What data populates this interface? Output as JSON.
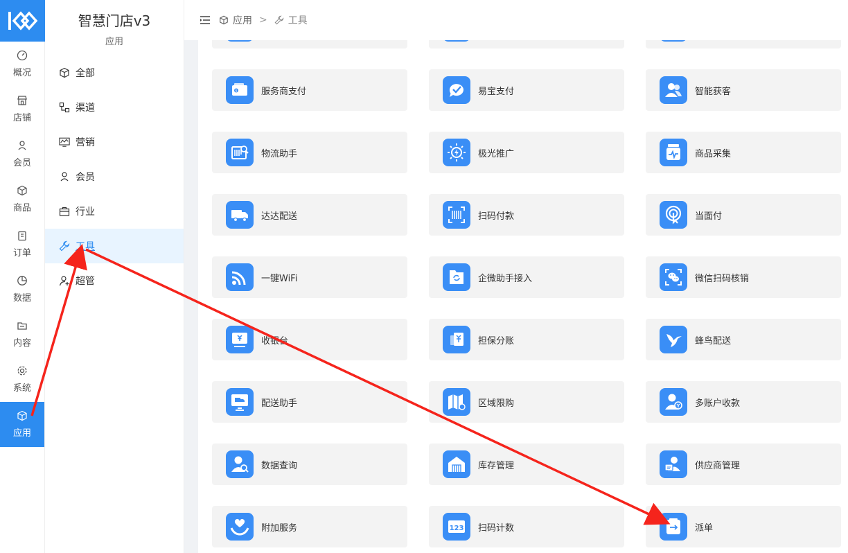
{
  "app": {
    "brand_color": "#2d8cf0",
    "title": "智慧门店v3",
    "subtitle": "应用"
  },
  "rail": {
    "items": [
      {
        "label": "概况",
        "icon": "dashboard-icon"
      },
      {
        "label": "店铺",
        "icon": "store-icon"
      },
      {
        "label": "会员",
        "icon": "user-icon"
      },
      {
        "label": "商品",
        "icon": "cube-icon"
      },
      {
        "label": "订单",
        "icon": "clipboard-icon"
      },
      {
        "label": "数据",
        "icon": "pie-chart-icon"
      },
      {
        "label": "内容",
        "icon": "folder-icon"
      },
      {
        "label": "系统",
        "icon": "gear-icon"
      },
      {
        "label": "应用",
        "icon": "cube-icon"
      }
    ]
  },
  "submenu": {
    "items": [
      {
        "label": "全部",
        "icon": "cube-icon"
      },
      {
        "label": "渠道",
        "icon": "channel-icon"
      },
      {
        "label": "营销",
        "icon": "chart-monitor-icon"
      },
      {
        "label": "会员",
        "icon": "user-icon"
      },
      {
        "label": "行业",
        "icon": "briefcase-icon"
      },
      {
        "label": "工具",
        "icon": "wrench-icon"
      },
      {
        "label": "超管",
        "icon": "admin-icon"
      }
    ]
  },
  "breadcrumb": {
    "level1": "应用",
    "separator": ">",
    "level2": "工具"
  },
  "tools": [
    {
      "label": "",
      "icon": "app-icon"
    },
    {
      "label": "",
      "icon": "app-icon"
    },
    {
      "label": "",
      "icon": "app-icon"
    },
    {
      "label": "服务商支付",
      "icon": "wallet-icon"
    },
    {
      "label": "易宝支付",
      "icon": "chat-check-icon"
    },
    {
      "label": "智能获客",
      "icon": "users-icon"
    },
    {
      "label": "物流助手",
      "icon": "barcode-search-icon"
    },
    {
      "label": "极光推广",
      "icon": "sun-bolt-icon"
    },
    {
      "label": "商品采集",
      "icon": "jar-pulse-icon"
    },
    {
      "label": "达达配送",
      "icon": "truck-icon"
    },
    {
      "label": "扫码付款",
      "icon": "scan-barcode-icon"
    },
    {
      "label": "当面付",
      "icon": "touch-icon"
    },
    {
      "label": "一键WiFi",
      "icon": "wifi-icon"
    },
    {
      "label": "企微助手接入",
      "icon": "folder-sync-icon"
    },
    {
      "label": "微信扫码核销",
      "icon": "wechat-scan-icon"
    },
    {
      "label": "收银台",
      "icon": "cashier-icon"
    },
    {
      "label": "担保分账",
      "icon": "yuan-cards-icon"
    },
    {
      "label": "蜂鸟配送",
      "icon": "hummingbird-icon"
    },
    {
      "label": "配送助手",
      "icon": "monitor-truck-icon"
    },
    {
      "label": "区域限购",
      "icon": "map-icon"
    },
    {
      "label": "多账户收款",
      "icon": "user-money-icon"
    },
    {
      "label": "数据查询",
      "icon": "user-search-icon"
    },
    {
      "label": "库存管理",
      "icon": "warehouse-icon"
    },
    {
      "label": "供应商管理",
      "icon": "id-card-icon"
    },
    {
      "label": "附加服务",
      "icon": "heart-hand-icon"
    },
    {
      "label": "扫码计数",
      "icon": "counter-123-icon"
    },
    {
      "label": "派单",
      "icon": "dispatch-icon"
    }
  ]
}
